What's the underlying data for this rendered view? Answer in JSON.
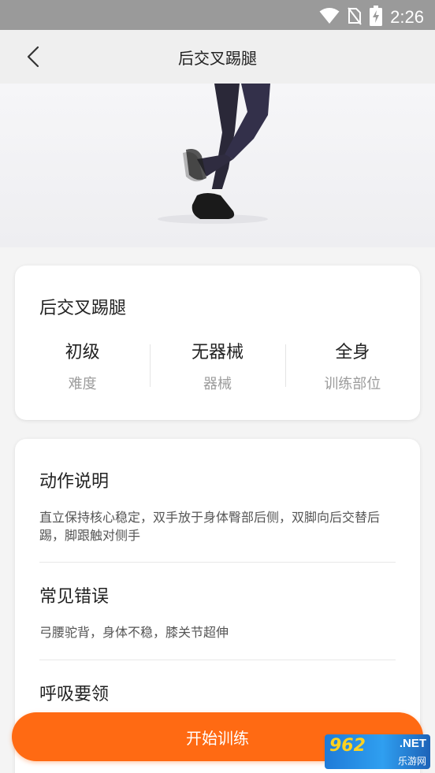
{
  "status_bar": {
    "time": "2:26",
    "icons": [
      "wifi-icon",
      "no-sim-icon",
      "battery-charging-icon"
    ]
  },
  "header": {
    "title": "后交叉踢腿",
    "back_icon": "chevron-left-icon"
  },
  "exercise": {
    "name": "后交叉踢腿",
    "stats": [
      {
        "value": "初级",
        "label": "难度"
      },
      {
        "value": "无器械",
        "label": "器械"
      },
      {
        "value": "全身",
        "label": "训练部位"
      }
    ]
  },
  "details": {
    "sections": [
      {
        "title": "动作说明",
        "text": "直立保持核心稳定，双手放于身体臀部后侧，双脚向后交替后踢，脚跟触对侧手"
      },
      {
        "title": "常见错误",
        "text": "弓腰驼背，身体不稳，膝关节超伸"
      },
      {
        "title": "呼吸要领",
        "text": ""
      }
    ]
  },
  "actions": {
    "start_label": "开始训练"
  },
  "watermark": {
    "brand": "962",
    "suffix": ".NET",
    "site": "乐游网"
  },
  "colors": {
    "accent": "#ff6a13",
    "status_bar": "#9a9a9a",
    "nav_bar": "#efefef"
  }
}
